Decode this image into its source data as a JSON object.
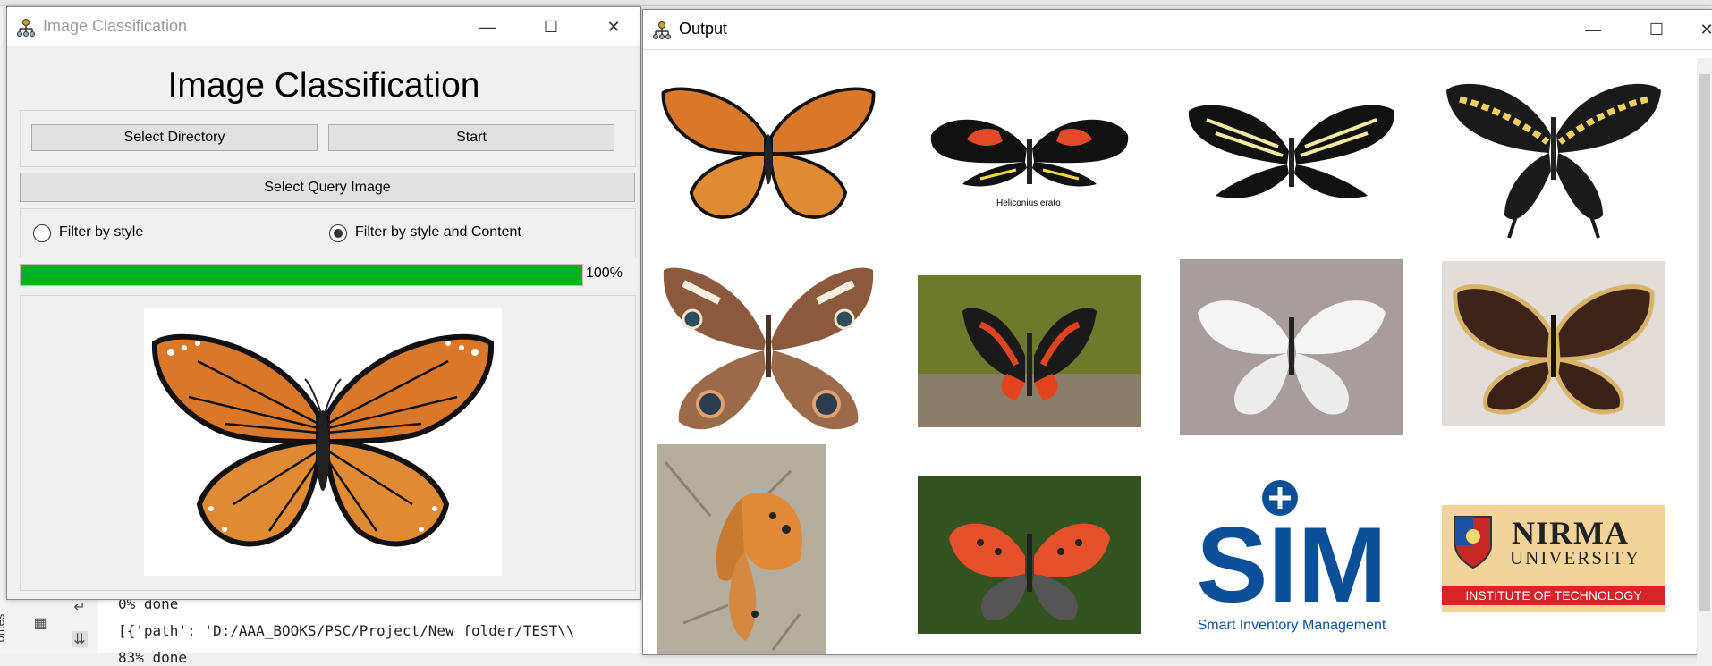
{
  "background": {
    "console_lines": [
      "0% done",
      "[{'path': 'D:/AAA_BOOKS/PSC/Project/New folder/TEST\\\\",
      "83% done"
    ],
    "side_text": "orites"
  },
  "main_window": {
    "title": "Image Classification",
    "heading": "Image Classification",
    "buttons": {
      "select_directory": "Select Directory",
      "start": "Start",
      "select_query_image": "Select Query Image"
    },
    "filters": {
      "option1": "Filter by style",
      "option2": "Filter by style and Content",
      "selected": "Filter by style and Content"
    },
    "progress": {
      "value": 1.0,
      "label": "100%"
    },
    "query_image": "monarch butterfly"
  },
  "output_window": {
    "title": "Output",
    "results": [
      {
        "subject": "monarch butterfly"
      },
      {
        "subject": "heliconius butterfly",
        "caption": "Heliconius erato"
      },
      {
        "subject": "zebra longwing butterfly"
      },
      {
        "subject": "giant swallowtail butterfly"
      },
      {
        "subject": "buckeye butterfly"
      },
      {
        "subject": "red admiral butterfly"
      },
      {
        "subject": "white butterfly"
      },
      {
        "subject": "mourning cloak butterfly"
      },
      {
        "subject": "painted lady butterfly"
      },
      {
        "subject": "small copper butterfly"
      },
      {
        "subject": "sim logo",
        "logo_text": "SIM",
        "tagline": "Smart Inventory Management"
      },
      {
        "subject": "nirma logo",
        "name": "NIRMA",
        "sub": "UNIVERSITY",
        "band": "INSTITUTE OF TECHNOLOGY"
      }
    ]
  },
  "colors": {
    "progress": "#06b025",
    "sim_blue": "#0a4f98",
    "nirma_red": "#d4262b",
    "nirma_gold": "#f2d39a"
  }
}
